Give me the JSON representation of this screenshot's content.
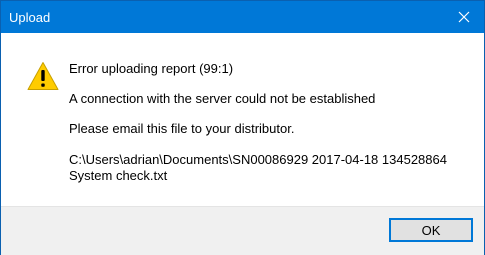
{
  "window": {
    "title": "Upload",
    "titlebar_color": "#0078d7"
  },
  "dialog": {
    "icon": "warning-icon",
    "heading": "Error uploading report (99:1)",
    "detail": "A connection with the server could not be established",
    "instruction": "Please email this file to your distributor.",
    "file_path": "C:\\Users\\adrian\\Documents\\SN00086929 2017-04-18 134528864 System check.txt"
  },
  "buttons": {
    "ok_label": "OK",
    "close_icon": "close-icon"
  }
}
